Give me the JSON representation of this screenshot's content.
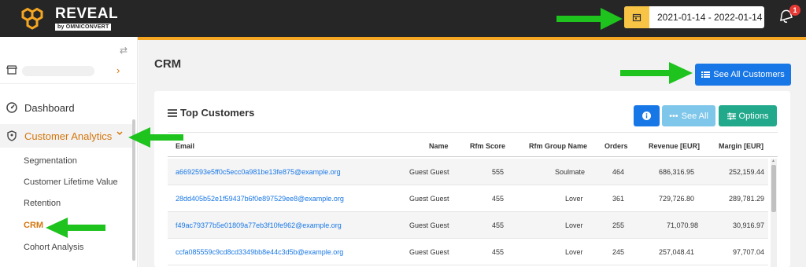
{
  "header": {
    "brand": "REVEAL",
    "brand_sub": "by OMNICONVERT",
    "date_range": "2021-01-14 - 2022-01-14",
    "notification_count": "1"
  },
  "sidebar": {
    "toggle_icon": "swap-icon",
    "nav": [
      {
        "label": "Dashboard",
        "icon": "gauge-icon"
      },
      {
        "label": "Customer Analytics",
        "icon": "user-shield-icon"
      }
    ],
    "sub_items": [
      {
        "label": "Segmentation"
      },
      {
        "label": "Customer Lifetime Value"
      },
      {
        "label": "Retention"
      },
      {
        "label": "CRM",
        "active": true
      },
      {
        "label": "Cohort Analysis"
      }
    ]
  },
  "main": {
    "title": "CRM",
    "see_all_customers": "See All Customers",
    "card_title": "Top Customers",
    "see_all": "See All",
    "options": "Options",
    "columns": [
      "Email",
      "Name",
      "Rfm Score",
      "Rfm Group Name",
      "Orders",
      "Revenue [EUR]",
      "Margin [EUR]"
    ],
    "rows": [
      [
        "a6692593e5ff0c5ecc0a981be13fe875@example.org",
        "Guest Guest",
        "555",
        "Soulmate",
        "464",
        "686,316.95",
        "252,159.44"
      ],
      [
        "28dd405b52e1f59437b6f0e897529ee8@example.org",
        "Guest Guest",
        "455",
        "Lover",
        "361",
        "729,726.80",
        "289,781.29"
      ],
      [
        "f49ac79377b5e01809a77eb3f10fe962@example.org",
        "Guest Guest",
        "455",
        "Lover",
        "255",
        "71,070.98",
        "30,916.97"
      ],
      [
        "ccfa085559c9cd8cd3349bb8e44c3d5b@example.org",
        "Guest Guest",
        "455",
        "Lover",
        "245",
        "257,048.41",
        "97,707.04"
      ]
    ]
  },
  "colors": {
    "header_bg": "#262626",
    "accent_orange": "#d4760c",
    "primary_blue": "#1877e6",
    "options_green": "#22a98c",
    "see_all_light_blue": "#7ec6ea",
    "annotation_arrow": "#1ec31e"
  }
}
